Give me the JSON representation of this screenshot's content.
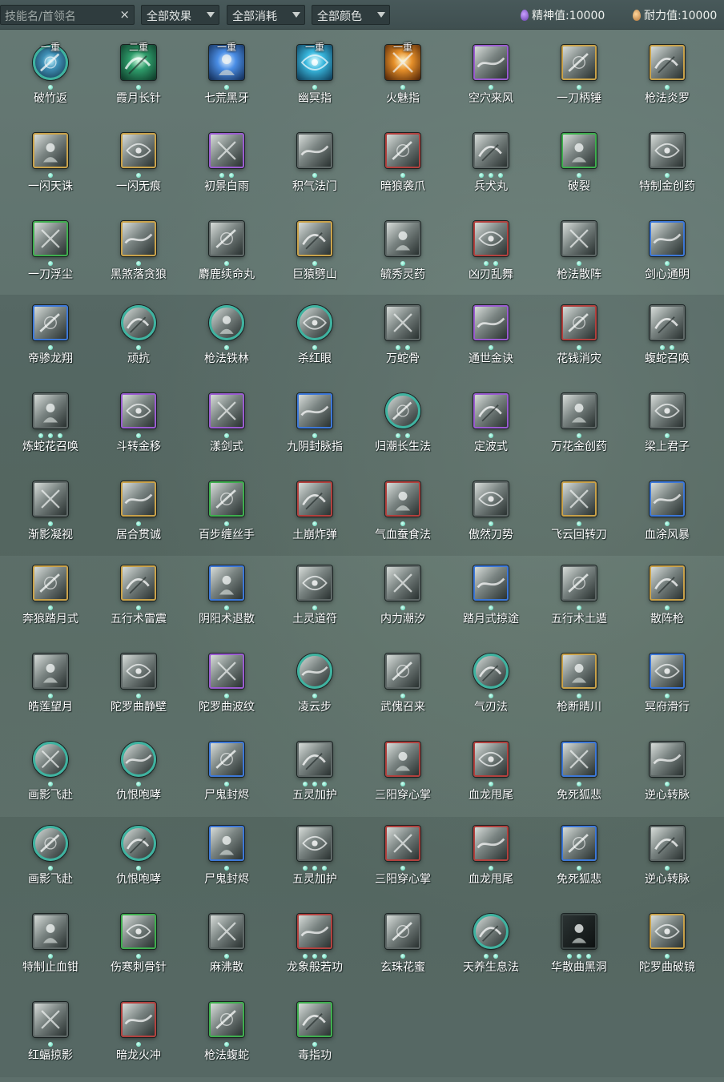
{
  "toolbar": {
    "search_placeholder": "技能名/首领名",
    "clear_icon": "×",
    "filters": [
      {
        "label": "全部效果",
        "icon": "dropdown-arrow"
      },
      {
        "label": "全部消耗",
        "icon": "dropdown-arrow"
      },
      {
        "label": "全部颜色",
        "icon": "dropdown-arrow"
      }
    ],
    "spirit": {
      "text": "精神值:10000",
      "icon": "purple-drop"
    },
    "endurance": {
      "text": "耐力值:10000",
      "icon": "orange-moon"
    }
  },
  "colors": {
    "gold": "#c9a24a",
    "purple": "#9a5cd0",
    "blue": "#3d78d8",
    "green": "#3fae4e",
    "red": "#b2413e",
    "teal": "#3fb3a0",
    "dot": "#4fd3b1"
  },
  "skills": [
    {
      "name": "破竹返",
      "border": "teal",
      "shape": "round",
      "tier": "一重",
      "art": "c-teal",
      "dots": 1
    },
    {
      "name": "霞月长针",
      "border": "none",
      "shape": "square",
      "tier": "二重",
      "art": "c-green",
      "dots": 1
    },
    {
      "name": "七荒黑牙",
      "border": "none",
      "shape": "square",
      "tier": "一重",
      "art": "c-blue",
      "dots": 1
    },
    {
      "name": "幽冥指",
      "border": "none",
      "shape": "square",
      "tier": "一重",
      "art": "c-cyan",
      "dots": 1
    },
    {
      "name": "火魅指",
      "border": "none",
      "shape": "square",
      "tier": "一重",
      "art": "c-fire",
      "dots": 1
    },
    {
      "name": "空穴来风",
      "border": "purple",
      "shape": "square",
      "tier": "",
      "art": "",
      "dots": 1
    },
    {
      "name": "一刀柄锤",
      "border": "gold",
      "shape": "square",
      "tier": "",
      "art": "",
      "dots": 1
    },
    {
      "name": "枪法炎罗",
      "border": "gold",
      "shape": "square",
      "tier": "",
      "art": "",
      "dots": 1
    },
    {
      "name": "一闪天诛",
      "border": "gold",
      "shape": "square",
      "tier": "",
      "art": "",
      "dots": 1
    },
    {
      "name": "一闪无痕",
      "border": "gold",
      "shape": "square",
      "tier": "",
      "art": "",
      "dots": 1
    },
    {
      "name": "初景白雨",
      "border": "purple",
      "shape": "square",
      "tier": "",
      "art": "",
      "dots": 2
    },
    {
      "name": "积气法门",
      "border": "gray",
      "shape": "square",
      "tier": "",
      "art": "",
      "dots": 1
    },
    {
      "name": "暗狼袭爪",
      "border": "red",
      "shape": "square",
      "tier": "",
      "art": "",
      "dots": 1
    },
    {
      "name": "兵犬丸",
      "border": "gray",
      "shape": "square",
      "tier": "",
      "art": "",
      "dots": 3
    },
    {
      "name": "破裂",
      "border": "green",
      "shape": "square",
      "tier": "",
      "art": "",
      "dots": 1
    },
    {
      "name": "特制金创药",
      "border": "gray",
      "shape": "square",
      "tier": "",
      "art": "",
      "dots": 1
    },
    {
      "name": "一刀浮尘",
      "border": "green",
      "shape": "square",
      "tier": "",
      "art": "",
      "dots": 1
    },
    {
      "name": "黑煞落贪狼",
      "border": "gold",
      "shape": "square",
      "tier": "",
      "art": "",
      "dots": 1
    },
    {
      "name": "麝鹿续命丸",
      "border": "gray",
      "shape": "square",
      "tier": "",
      "art": "",
      "dots": 1
    },
    {
      "name": "巨猿劈山",
      "border": "gold",
      "shape": "square",
      "tier": "",
      "art": "",
      "dots": 1
    },
    {
      "name": "毓秀灵药",
      "border": "gray",
      "shape": "square",
      "tier": "",
      "art": "",
      "dots": 1
    },
    {
      "name": "凶刃乱舞",
      "border": "red",
      "shape": "square",
      "tier": "",
      "art": "",
      "dots": 2
    },
    {
      "name": "枪法散阵",
      "border": "gray",
      "shape": "square",
      "tier": "",
      "art": "",
      "dots": 1
    },
    {
      "name": "剑心通明",
      "border": "blue",
      "shape": "square",
      "tier": "",
      "art": "",
      "dots": 1
    },
    {
      "name": "帝骖龙翔",
      "border": "blue",
      "shape": "square",
      "tier": "",
      "art": "",
      "dots": 1
    },
    {
      "name": "顽抗",
      "border": "teal",
      "shape": "round",
      "tier": "",
      "art": "",
      "dots": 1
    },
    {
      "name": "枪法铁林",
      "border": "teal",
      "shape": "round",
      "tier": "",
      "art": "",
      "dots": 1
    },
    {
      "name": "杀红眼",
      "border": "teal",
      "shape": "round",
      "tier": "",
      "art": "",
      "dots": 1
    },
    {
      "name": "万蛇骨",
      "border": "gray",
      "shape": "square",
      "tier": "",
      "art": "",
      "dots": 2
    },
    {
      "name": "通世金诀",
      "border": "purple",
      "shape": "square",
      "tier": "",
      "art": "",
      "dots": 1
    },
    {
      "name": "花钱消灾",
      "border": "red",
      "shape": "square",
      "tier": "",
      "art": "",
      "dots": 1
    },
    {
      "name": "蝮蛇召唤",
      "border": "gray",
      "shape": "square",
      "tier": "",
      "art": "",
      "dots": 2
    },
    {
      "name": "炼蛇花召唤",
      "border": "gray",
      "shape": "square",
      "tier": "",
      "art": "",
      "dots": 3
    },
    {
      "name": "斗转金移",
      "border": "purple",
      "shape": "square",
      "tier": "",
      "art": "",
      "dots": 1
    },
    {
      "name": "漾剑式",
      "border": "purple",
      "shape": "square",
      "tier": "",
      "art": "",
      "dots": 1
    },
    {
      "name": "九阴封脉指",
      "border": "blue",
      "shape": "square",
      "tier": "",
      "art": "",
      "dots": 1
    },
    {
      "name": "归潮长生法",
      "border": "teal",
      "shape": "round",
      "tier": "",
      "art": "",
      "dots": 2
    },
    {
      "name": "定波式",
      "border": "purple",
      "shape": "square",
      "tier": "",
      "art": "",
      "dots": 1
    },
    {
      "name": "万花金创药",
      "border": "gray",
      "shape": "square",
      "tier": "",
      "art": "",
      "dots": 1
    },
    {
      "name": "梁上君子",
      "border": "gray",
      "shape": "square",
      "tier": "",
      "art": "",
      "dots": 1
    },
    {
      "name": "渐影凝视",
      "border": "gray",
      "shape": "square",
      "tier": "",
      "art": "",
      "dots": 1
    },
    {
      "name": "居合贯诚",
      "border": "gold",
      "shape": "square",
      "tier": "",
      "art": "",
      "dots": 1
    },
    {
      "name": "百步缠丝手",
      "border": "green",
      "shape": "square",
      "tier": "",
      "art": "",
      "dots": 1
    },
    {
      "name": "土崩炸弹",
      "border": "red",
      "shape": "square",
      "tier": "",
      "art": "",
      "dots": 1
    },
    {
      "name": "气血蚕食法",
      "border": "red",
      "shape": "square",
      "tier": "",
      "art": "",
      "dots": 1
    },
    {
      "name": "傲然刀势",
      "border": "gray",
      "shape": "square",
      "tier": "",
      "art": "",
      "dots": 1
    },
    {
      "name": "飞云回转刀",
      "border": "gold",
      "shape": "square",
      "tier": "",
      "art": "",
      "dots": 1
    },
    {
      "name": "血涂风暴",
      "border": "blue",
      "shape": "square",
      "tier": "",
      "art": "",
      "dots": 1
    },
    {
      "name": "奔狼踏月式",
      "border": "gold",
      "shape": "square",
      "tier": "",
      "art": "",
      "dots": 1
    },
    {
      "name": "五行术雷震",
      "border": "gold",
      "shape": "square",
      "tier": "",
      "art": "",
      "dots": 1
    },
    {
      "name": "阴阳术退散",
      "border": "blue",
      "shape": "square",
      "tier": "",
      "art": "",
      "dots": 1
    },
    {
      "name": "土灵道符",
      "border": "gray",
      "shape": "square",
      "tier": "",
      "art": "",
      "dots": 1
    },
    {
      "name": "内力潮汐",
      "border": "gray",
      "shape": "square",
      "tier": "",
      "art": "",
      "dots": 1
    },
    {
      "name": "踏月式掠途",
      "border": "blue",
      "shape": "square",
      "tier": "",
      "art": "",
      "dots": 1
    },
    {
      "name": "五行术土遁",
      "border": "gray",
      "shape": "square",
      "tier": "",
      "art": "",
      "dots": 1
    },
    {
      "name": "散阵枪",
      "border": "gold",
      "shape": "square",
      "tier": "",
      "art": "",
      "dots": 1
    },
    {
      "name": "皓莲望月",
      "border": "gray",
      "shape": "square",
      "tier": "",
      "art": "",
      "dots": 1
    },
    {
      "name": "陀罗曲静壁",
      "border": "gray",
      "shape": "square",
      "tier": "",
      "art": "",
      "dots": 1
    },
    {
      "name": "陀罗曲波纹",
      "border": "purple",
      "shape": "square",
      "tier": "",
      "art": "",
      "dots": 1
    },
    {
      "name": "凌云步",
      "border": "teal",
      "shape": "round",
      "tier": "",
      "art": "",
      "dots": 1
    },
    {
      "name": "武傀召来",
      "border": "gray",
      "shape": "square",
      "tier": "",
      "art": "",
      "dots": 1
    },
    {
      "name": "气刃法",
      "border": "teal",
      "shape": "round",
      "tier": "",
      "art": "",
      "dots": 1
    },
    {
      "name": "枪断晴川",
      "border": "gold",
      "shape": "square",
      "tier": "",
      "art": "",
      "dots": 1
    },
    {
      "name": "冥府滑行",
      "border": "blue",
      "shape": "square",
      "tier": "",
      "art": "",
      "dots": 1
    },
    {
      "name": "画影飞赴",
      "border": "teal",
      "shape": "round",
      "tier": "",
      "art": "",
      "dots": 1
    },
    {
      "name": "仇恨咆哮",
      "border": "teal",
      "shape": "round",
      "tier": "",
      "art": "",
      "dots": 1
    },
    {
      "name": "尸鬼封烬",
      "border": "blue",
      "shape": "square",
      "tier": "",
      "art": "",
      "dots": 1
    },
    {
      "name": "五灵加护",
      "border": "gray",
      "shape": "square",
      "tier": "",
      "art": "",
      "dots": 3
    },
    {
      "name": "三阳穿心掌",
      "border": "red",
      "shape": "square",
      "tier": "",
      "art": "",
      "dots": 1
    },
    {
      "name": "血龙甩尾",
      "border": "red",
      "shape": "square",
      "tier": "",
      "art": "",
      "dots": 1
    },
    {
      "name": "免死狐悲",
      "border": "blue",
      "shape": "square",
      "tier": "",
      "art": "",
      "dots": 1
    },
    {
      "name": "逆心转脉",
      "border": "gray",
      "shape": "square",
      "tier": "",
      "art": "",
      "dots": 1
    },
    {
      "name": "画影飞赴",
      "border": "teal",
      "shape": "round",
      "tier": "",
      "art": "",
      "dots": 1
    },
    {
      "name": "仇恨咆哮",
      "border": "teal",
      "shape": "round",
      "tier": "",
      "art": "",
      "dots": 1
    },
    {
      "name": "尸鬼封烬",
      "border": "blue",
      "shape": "square",
      "tier": "",
      "art": "",
      "dots": 1
    },
    {
      "name": "五灵加护",
      "border": "gray",
      "shape": "square",
      "tier": "",
      "art": "",
      "dots": 3
    },
    {
      "name": "三阳穿心掌",
      "border": "red",
      "shape": "square",
      "tier": "",
      "art": "",
      "dots": 1
    },
    {
      "name": "血龙甩尾",
      "border": "red",
      "shape": "square",
      "tier": "",
      "art": "",
      "dots": 1
    },
    {
      "name": "免死狐悲",
      "border": "blue",
      "shape": "square",
      "tier": "",
      "art": "",
      "dots": 1
    },
    {
      "name": "逆心转脉",
      "border": "gray",
      "shape": "square",
      "tier": "",
      "art": "",
      "dots": 1
    },
    {
      "name": "特制止血钳",
      "border": "gray",
      "shape": "square",
      "tier": "",
      "art": "",
      "dots": 1
    },
    {
      "name": "伤寒刺骨针",
      "border": "green",
      "shape": "square",
      "tier": "",
      "art": "",
      "dots": 1
    },
    {
      "name": "麻沸散",
      "border": "gray",
      "shape": "square",
      "tier": "",
      "art": "",
      "dots": 1
    },
    {
      "name": "龙象般若功",
      "border": "red",
      "shape": "square",
      "tier": "",
      "art": "",
      "dots": 3
    },
    {
      "name": "玄珠花蜜",
      "border": "gray",
      "shape": "square",
      "tier": "",
      "art": "",
      "dots": 1
    },
    {
      "name": "天养生息法",
      "border": "teal",
      "shape": "round",
      "tier": "",
      "art": "",
      "dots": 2
    },
    {
      "name": "华散曲黑洞",
      "border": "dark",
      "shape": "square",
      "tier": "",
      "art": "",
      "dots": 3
    },
    {
      "name": "陀罗曲破镜",
      "border": "gold",
      "shape": "square",
      "tier": "",
      "art": "",
      "dots": 1
    },
    {
      "name": "红蝠掠影",
      "border": "gray",
      "shape": "square",
      "tier": "",
      "art": "",
      "dots": 1
    },
    {
      "name": "暗龙火冲",
      "border": "red",
      "shape": "square",
      "tier": "",
      "art": "",
      "dots": 1
    },
    {
      "name": "枪法蝮蛇",
      "border": "green",
      "shape": "square",
      "tier": "",
      "art": "",
      "dots": 1
    },
    {
      "name": "毒指功",
      "border": "green",
      "shape": "square",
      "tier": "",
      "art": "",
      "dots": 1
    }
  ]
}
